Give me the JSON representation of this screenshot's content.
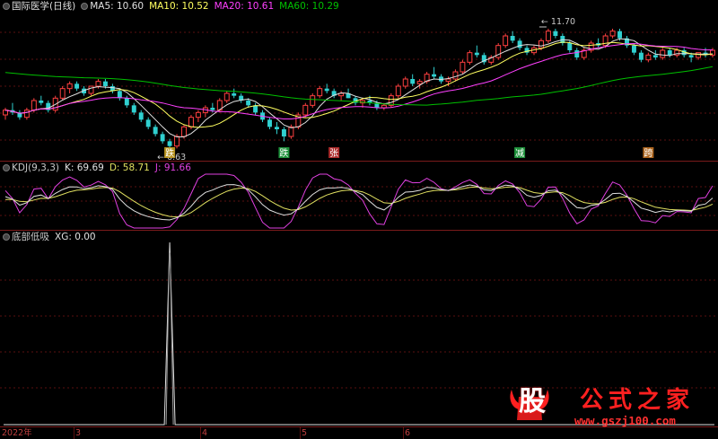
{
  "colors": {
    "bg": "#000000",
    "grid": "#5a1010",
    "divider": "#7a1a1a",
    "up": "#ff4040",
    "down": "#30d0d0",
    "ma5": "#e0e0e0",
    "ma10": "#ffff60",
    "ma20": "#ff40ff",
    "ma60": "#00c000",
    "k": "#e0e0e0",
    "d": "#e0e060",
    "j": "#e040e0",
    "xg": "#e0e0e0",
    "signal_down": "#3080ff",
    "signal_up": "#ffa030",
    "signal_cn_green": "#20ff40"
  },
  "panel_main": {
    "title": "国际医学(日线)",
    "ma": [
      {
        "label": "MA5: 10.60",
        "color": "#e0e0e0"
      },
      {
        "label": "MA10: 10.52",
        "color": "#ffff60"
      },
      {
        "label": "MA20: 10.61",
        "color": "#ff40ff"
      },
      {
        "label": "MA60: 10.29",
        "color": "#00c000"
      }
    ],
    "high_label": "11.70",
    "low_label": "6.63",
    "signals": [
      {
        "text": "跌",
        "kind": "jiang"
      },
      {
        "text": "跌",
        "kind": "die"
      },
      {
        "text": "张",
        "kind": "zhang"
      },
      {
        "text": "减",
        "kind": "jian"
      },
      {
        "text": "跨",
        "kind": "kua"
      }
    ]
  },
  "panel_kdj": {
    "title": "KDJ(9,3,3)",
    "k_label": "K: 69.69",
    "d_label": "D: 58.71",
    "j_label": "J: 91.66"
  },
  "panel_xg": {
    "title": "底部低吸",
    "xg_label": "XG: 0.00"
  },
  "x_axis": {
    "labels": [
      {
        "text": "2022年"
      },
      {
        "text": "3"
      },
      {
        "text": "4"
      },
      {
        "text": "5"
      },
      {
        "text": "6"
      }
    ]
  },
  "watermark": {
    "badge": "股",
    "title": "公式之家",
    "url": "www.gszj100.com"
  },
  "chart_data": {
    "type": "candlestick",
    "title": "国际医学(日线)",
    "y_range": [
      6.3,
      12.3
    ],
    "candles": [
      [
        8.1,
        8.4,
        7.9,
        8.3
      ],
      [
        8.3,
        8.6,
        8.1,
        8.2
      ],
      [
        8.2,
        8.3,
        7.9,
        8.0
      ],
      [
        8.0,
        8.4,
        7.9,
        8.3
      ],
      [
        8.3,
        8.8,
        8.2,
        8.7
      ],
      [
        8.7,
        8.9,
        8.5,
        8.6
      ],
      [
        8.6,
        8.7,
        8.2,
        8.3
      ],
      [
        8.3,
        8.9,
        8.2,
        8.8
      ],
      [
        8.8,
        9.3,
        8.7,
        9.2
      ],
      [
        9.2,
        9.5,
        9.0,
        9.4
      ],
      [
        9.4,
        9.5,
        9.1,
        9.2
      ],
      [
        9.2,
        9.3,
        8.9,
        9.0
      ],
      [
        9.0,
        9.3,
        8.9,
        9.3
      ],
      [
        9.3,
        9.6,
        9.2,
        9.5
      ],
      [
        9.5,
        9.6,
        9.2,
        9.3
      ],
      [
        9.3,
        9.4,
        9.0,
        9.1
      ],
      [
        9.1,
        9.2,
        8.7,
        8.8
      ],
      [
        8.8,
        8.9,
        8.4,
        8.5
      ],
      [
        8.5,
        8.6,
        8.1,
        8.2
      ],
      [
        8.2,
        8.3,
        7.8,
        7.9
      ],
      [
        7.9,
        8.0,
        7.5,
        7.6
      ],
      [
        7.6,
        7.7,
        7.2,
        7.3
      ],
      [
        7.3,
        7.4,
        6.9,
        7.0
      ],
      [
        7.0,
        7.1,
        6.63,
        6.8
      ],
      [
        6.8,
        7.3,
        6.7,
        7.2
      ],
      [
        7.2,
        7.7,
        7.1,
        7.6
      ],
      [
        7.6,
        8.1,
        7.5,
        8.0
      ],
      [
        8.0,
        8.3,
        7.8,
        8.2
      ],
      [
        8.2,
        8.5,
        8.0,
        8.4
      ],
      [
        8.4,
        8.6,
        8.2,
        8.3
      ],
      [
        8.3,
        8.8,
        8.2,
        8.7
      ],
      [
        8.7,
        9.1,
        8.6,
        9.0
      ],
      [
        9.0,
        9.2,
        8.8,
        8.9
      ],
      [
        8.9,
        9.0,
        8.6,
        8.7
      ],
      [
        8.7,
        8.8,
        8.4,
        8.5
      ],
      [
        8.5,
        8.6,
        8.1,
        8.2
      ],
      [
        8.2,
        8.3,
        7.8,
        7.9
      ],
      [
        7.9,
        8.0,
        7.5,
        7.6
      ],
      [
        7.6,
        7.8,
        7.3,
        7.5
      ],
      [
        7.5,
        7.6,
        7.0,
        7.2
      ],
      [
        7.2,
        7.7,
        7.1,
        7.6
      ],
      [
        7.6,
        8.2,
        7.5,
        8.1
      ],
      [
        8.1,
        8.6,
        8.0,
        8.5
      ],
      [
        8.5,
        9.0,
        8.4,
        8.9
      ],
      [
        8.9,
        9.3,
        8.8,
        9.2
      ],
      [
        9.2,
        9.4,
        9.0,
        9.1
      ],
      [
        9.1,
        9.2,
        8.8,
        8.9
      ],
      [
        8.9,
        9.1,
        8.7,
        9.0
      ],
      [
        9.0,
        9.2,
        8.8,
        8.8
      ],
      [
        8.8,
        8.9,
        8.5,
        8.6
      ],
      [
        8.6,
        8.8,
        8.4,
        8.7
      ],
      [
        8.7,
        8.9,
        8.5,
        8.6
      ],
      [
        8.6,
        8.7,
        8.3,
        8.4
      ],
      [
        8.4,
        8.6,
        8.3,
        8.5
      ],
      [
        8.5,
        9.0,
        8.4,
        8.9
      ],
      [
        8.9,
        9.4,
        8.8,
        9.3
      ],
      [
        9.3,
        9.7,
        9.2,
        9.6
      ],
      [
        9.6,
        9.8,
        9.3,
        9.4
      ],
      [
        9.4,
        9.6,
        9.2,
        9.5
      ],
      [
        9.5,
        9.9,
        9.4,
        9.8
      ],
      [
        9.8,
        10.1,
        9.6,
        9.7
      ],
      [
        9.7,
        9.8,
        9.4,
        9.5
      ],
      [
        9.5,
        9.7,
        9.3,
        9.6
      ],
      [
        9.6,
        10.0,
        9.5,
        9.9
      ],
      [
        9.9,
        10.4,
        9.8,
        10.3
      ],
      [
        10.3,
        10.8,
        10.2,
        10.7
      ],
      [
        10.7,
        11.0,
        10.5,
        10.6
      ],
      [
        10.6,
        10.7,
        10.2,
        10.3
      ],
      [
        10.3,
        10.6,
        10.2,
        10.5
      ],
      [
        10.5,
        11.1,
        10.4,
        11.0
      ],
      [
        11.0,
        11.5,
        10.9,
        11.4
      ],
      [
        11.4,
        11.6,
        11.1,
        11.2
      ],
      [
        11.2,
        11.3,
        10.8,
        10.9
      ],
      [
        10.9,
        11.0,
        10.6,
        10.7
      ],
      [
        10.7,
        11.0,
        10.6,
        10.9
      ],
      [
        10.9,
        11.3,
        10.8,
        11.2
      ],
      [
        11.2,
        11.7,
        11.1,
        11.6
      ],
      [
        11.6,
        11.7,
        11.3,
        11.4
      ],
      [
        11.4,
        11.5,
        11.0,
        11.1
      ],
      [
        11.1,
        11.2,
        10.7,
        10.8
      ],
      [
        10.8,
        10.9,
        10.4,
        10.5
      ],
      [
        10.5,
        10.9,
        10.4,
        10.8
      ],
      [
        10.8,
        11.2,
        10.7,
        11.1
      ],
      [
        11.1,
        11.3,
        10.9,
        11.0
      ],
      [
        11.0,
        11.5,
        10.9,
        11.4
      ],
      [
        11.4,
        11.7,
        11.3,
        11.6
      ],
      [
        11.6,
        11.7,
        11.2,
        11.3
      ],
      [
        11.3,
        11.4,
        10.9,
        11.0
      ],
      [
        11.0,
        11.1,
        10.6,
        10.7
      ],
      [
        10.7,
        10.8,
        10.3,
        10.4
      ],
      [
        10.4,
        10.7,
        10.3,
        10.6
      ],
      [
        10.6,
        10.8,
        10.4,
        10.5
      ],
      [
        10.5,
        10.9,
        10.4,
        10.8
      ],
      [
        10.8,
        10.9,
        10.5,
        10.6
      ],
      [
        10.6,
        10.9,
        10.5,
        10.8
      ],
      [
        10.8,
        10.9,
        10.5,
        10.6
      ],
      [
        10.6,
        10.7,
        10.3,
        10.5
      ],
      [
        10.5,
        10.7,
        10.4,
        10.7
      ],
      [
        10.7,
        10.9,
        10.5,
        10.6
      ],
      [
        10.6,
        10.9,
        10.5,
        10.8
      ]
    ],
    "kdj_range": [
      -10,
      110
    ],
    "xg_range": [
      0,
      1
    ],
    "xg_spike_index": 23
  }
}
